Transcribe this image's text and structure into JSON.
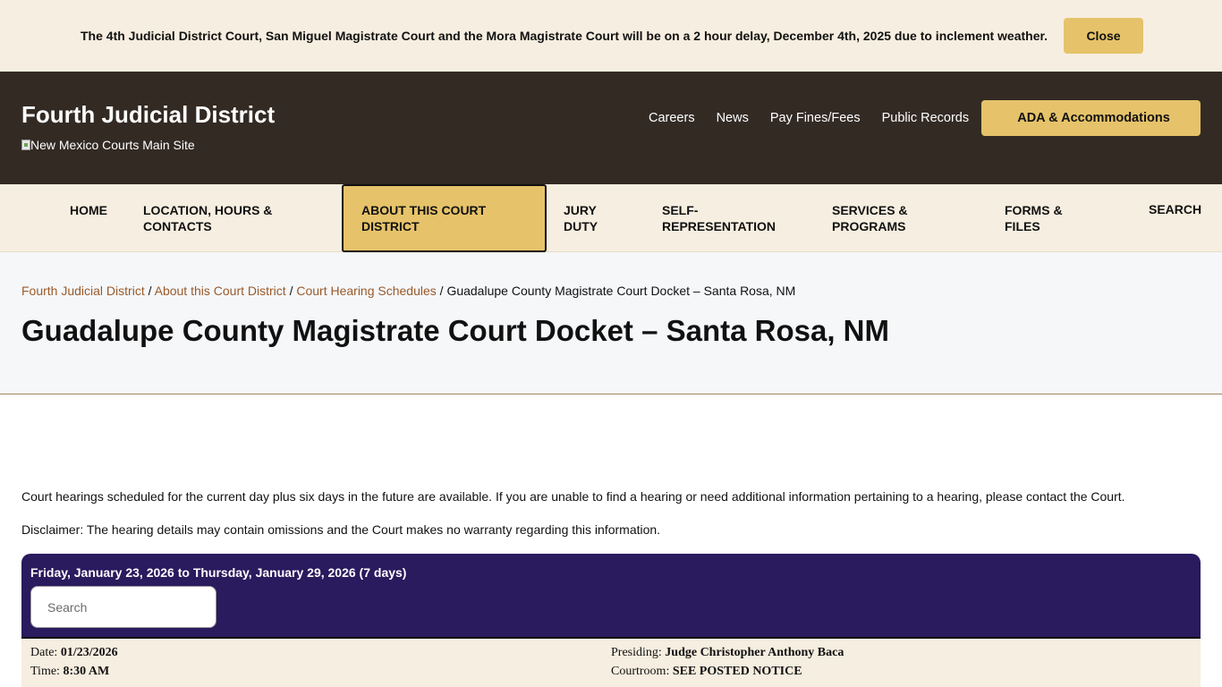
{
  "alert": {
    "message": "The 4th Judicial District Court, San Miguel Magistrate Court and the Mora Magistrate Court will be on a 2 hour delay, December 4th, 2025 due to inclement weather.",
    "close_label": "Close"
  },
  "header": {
    "site_title": "Fourth Judicial District",
    "main_site_alt": "New Mexico Courts Main Site",
    "links": [
      "Careers",
      "News",
      "Pay Fines/Fees",
      "Public Records"
    ],
    "ada_label": "ADA & Accommodations"
  },
  "nav": {
    "items": [
      {
        "label": "Home"
      },
      {
        "label": "Location, Hours & Contacts"
      },
      {
        "label": "About this Court District"
      },
      {
        "label": "Jury Duty"
      },
      {
        "label": "Self-Representation"
      },
      {
        "label": "Services & Programs"
      },
      {
        "label": "Forms & Files"
      },
      {
        "label": "Search"
      }
    ],
    "active_index": 2
  },
  "breadcrumb": {
    "items": [
      "Fourth Judicial District",
      "About this Court District",
      "Court Hearing Schedules"
    ],
    "current": "Guadalupe County Magistrate Court Docket – Santa Rosa, NM",
    "separator": "/"
  },
  "page_title": "Guadalupe County Magistrate Court Docket – Santa Rosa, NM",
  "content": {
    "intro": "Court hearings scheduled for the current day plus six days in the future are available. If you are unable to find a hearing or need additional information pertaining to a hearing, please contact the Court.",
    "disclaimer": "Disclaimer:  The hearing details may contain omissions and the Court makes no warranty regarding this information."
  },
  "docket": {
    "range_label": "Friday, January 23, 2026 to Thursday, January 29, 2026 (7 days)",
    "search_placeholder": "Search",
    "entries": [
      {
        "date_label": "Date:",
        "date": "01/23/2026",
        "time_label": "Time:",
        "time": "8:30 AM",
        "presiding_label": "Presiding:",
        "presiding": "Judge Christopher Anthony Baca",
        "courtroom_label": "Courtroom:",
        "courtroom": "SEE POSTED NOTICE"
      }
    ]
  },
  "colors": {
    "banner_bg": "#f6eee0",
    "accent_gold": "#e6c36a",
    "header_bg": "#332a24",
    "docket_header_bg": "#2a1a5e",
    "breadcrumb_link": "#9a5a2a"
  }
}
